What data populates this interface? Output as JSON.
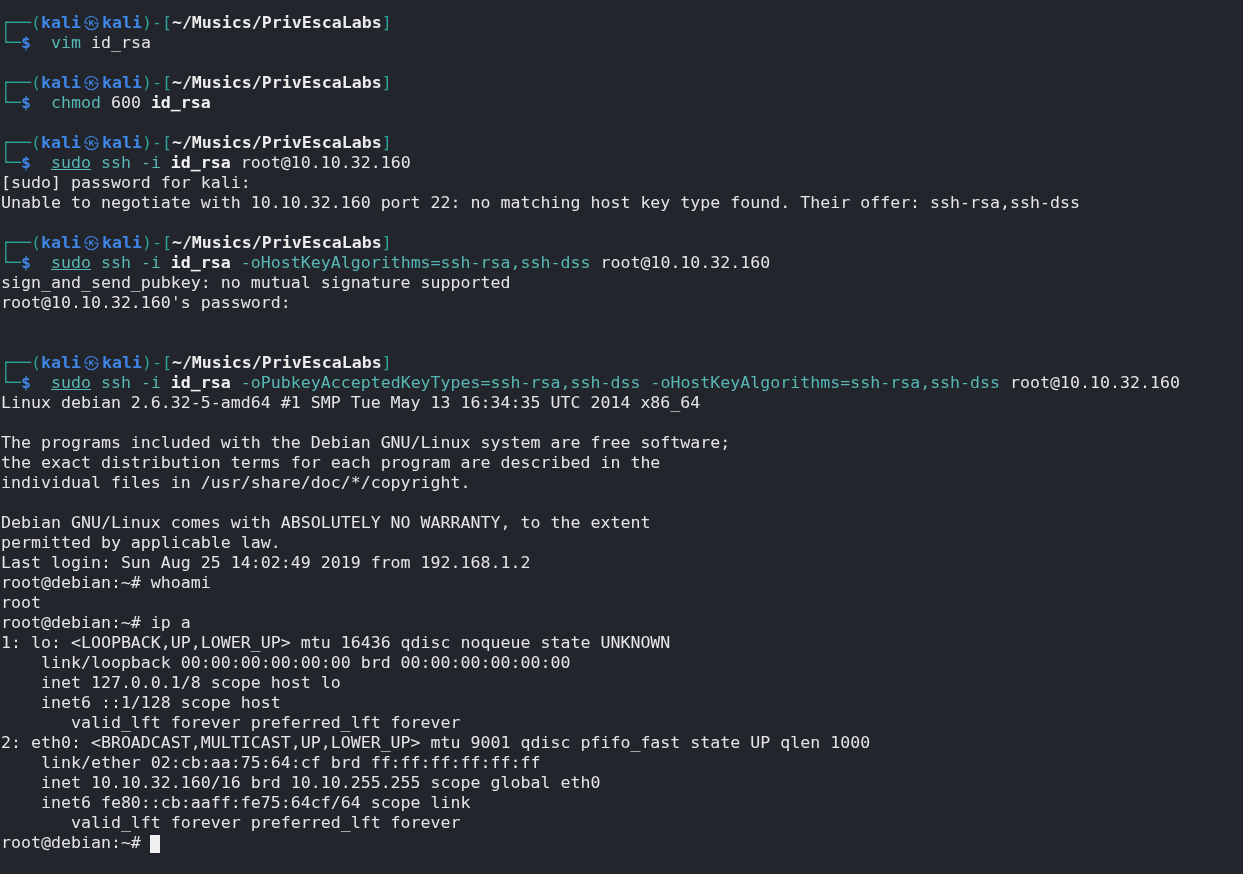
{
  "terminal": {
    "lines": [
      {
        "kind": "prompt",
        "open": "┌──(",
        "user": "kali",
        "at": "㉿",
        "host": "kali",
        "mid": ")-[",
        "path": "~/Musics/PrivEscaLabs",
        "close": "]"
      },
      {
        "kind": "command",
        "corner": "└─",
        "symbol": "$",
        "tokens": [
          {
            "text": "vim",
            "kind": "cmd"
          },
          {
            "text": "id_rsa",
            "kind": "plain"
          }
        ]
      },
      {
        "kind": "blank"
      },
      {
        "kind": "prompt",
        "open": "┌──(",
        "user": "kali",
        "at": "㉿",
        "host": "kali",
        "mid": ")-[",
        "path": "~/Musics/PrivEscaLabs",
        "close": "]"
      },
      {
        "kind": "command",
        "corner": "└─",
        "symbol": "$",
        "tokens": [
          {
            "text": "chmod",
            "kind": "cmd"
          },
          {
            "text": "600",
            "kind": "plain"
          },
          {
            "text": "id_rsa",
            "kind": "bold"
          }
        ]
      },
      {
        "kind": "blank"
      },
      {
        "kind": "prompt",
        "open": "┌──(",
        "user": "kali",
        "at": "㉿",
        "host": "kali",
        "mid": ")-[",
        "path": "~/Musics/PrivEscaLabs",
        "close": "]"
      },
      {
        "kind": "command",
        "corner": "└─",
        "symbol": "$",
        "tokens": [
          {
            "text": "sudo",
            "kind": "sudo"
          },
          {
            "text": "ssh",
            "kind": "cmd"
          },
          {
            "text": "-i",
            "kind": "cmd"
          },
          {
            "text": "id_rsa",
            "kind": "bold"
          },
          {
            "text": "root@10.10.32.160",
            "kind": "plain"
          }
        ]
      },
      {
        "kind": "output",
        "text": "[sudo] password for kali:"
      },
      {
        "kind": "output",
        "text": "Unable to negotiate with 10.10.32.160 port 22: no matching host key type found. Their offer: ssh-rsa,ssh-dss"
      },
      {
        "kind": "blank"
      },
      {
        "kind": "prompt",
        "open": "┌──(",
        "user": "kali",
        "at": "㉿",
        "host": "kali",
        "mid": ")-[",
        "path": "~/Musics/PrivEscaLabs",
        "close": "]"
      },
      {
        "kind": "command",
        "corner": "└─",
        "symbol": "$",
        "tokens": [
          {
            "text": "sudo",
            "kind": "sudo"
          },
          {
            "text": "ssh",
            "kind": "cmd"
          },
          {
            "text": "-i",
            "kind": "cmd"
          },
          {
            "text": "id_rsa",
            "kind": "bold"
          },
          {
            "text": "-oHostKeyAlgorithms=ssh-rsa,ssh-dss",
            "kind": "cmd"
          },
          {
            "text": "root@10.10.32.160",
            "kind": "plain"
          }
        ]
      },
      {
        "kind": "output",
        "text": "sign_and_send_pubkey: no mutual signature supported"
      },
      {
        "kind": "output",
        "text": "root@10.10.32.160's password:"
      },
      {
        "kind": "blank"
      },
      {
        "kind": "blank"
      },
      {
        "kind": "prompt",
        "open": "┌──(",
        "user": "kali",
        "at": "㉿",
        "host": "kali",
        "mid": ")-[",
        "path": "~/Musics/PrivEscaLabs",
        "close": "]"
      },
      {
        "kind": "command",
        "corner": "└─",
        "symbol": "$",
        "tokens": [
          {
            "text": "sudo",
            "kind": "sudo"
          },
          {
            "text": "ssh",
            "kind": "cmd"
          },
          {
            "text": "-i",
            "kind": "cmd"
          },
          {
            "text": "id_rsa",
            "kind": "bold"
          },
          {
            "text": "-oPubkeyAcceptedKeyTypes=ssh-rsa,ssh-dss",
            "kind": "cmd"
          },
          {
            "text": "-oHostKeyAlgorithms=ssh-rsa,ssh-dss",
            "kind": "cmd"
          },
          {
            "text": "root@10.10.32.160",
            "kind": "plain"
          }
        ]
      },
      {
        "kind": "output",
        "text": "Linux debian 2.6.32-5-amd64 #1 SMP Tue May 13 16:34:35 UTC 2014 x86_64"
      },
      {
        "kind": "blank"
      },
      {
        "kind": "output",
        "text": "The programs included with the Debian GNU/Linux system are free software;"
      },
      {
        "kind": "output",
        "text": "the exact distribution terms for each program are described in the"
      },
      {
        "kind": "output",
        "text": "individual files in /usr/share/doc/*/copyright."
      },
      {
        "kind": "blank"
      },
      {
        "kind": "output",
        "text": "Debian GNU/Linux comes with ABSOLUTELY NO WARRANTY, to the extent"
      },
      {
        "kind": "output",
        "text": "permitted by applicable law."
      },
      {
        "kind": "output",
        "text": "Last login: Sun Aug 25 14:02:49 2019 from 192.168.1.2"
      },
      {
        "kind": "output",
        "text": "root@debian:~# whoami"
      },
      {
        "kind": "output",
        "text": "root"
      },
      {
        "kind": "output",
        "text": "root@debian:~# ip a"
      },
      {
        "kind": "output",
        "text": "1: lo: <LOOPBACK,UP,LOWER_UP> mtu 16436 qdisc noqueue state UNKNOWN"
      },
      {
        "kind": "output",
        "text": "    link/loopback 00:00:00:00:00:00 brd 00:00:00:00:00:00"
      },
      {
        "kind": "output",
        "text": "    inet 127.0.0.1/8 scope host lo"
      },
      {
        "kind": "output",
        "text": "    inet6 ::1/128 scope host"
      },
      {
        "kind": "output",
        "text": "       valid_lft forever preferred_lft forever"
      },
      {
        "kind": "output",
        "text": "2: eth0: <BROADCAST,MULTICAST,UP,LOWER_UP> mtu 9001 qdisc pfifo_fast state UP qlen 1000"
      },
      {
        "kind": "output",
        "text": "    link/ether 02:cb:aa:75:64:cf brd ff:ff:ff:ff:ff:ff"
      },
      {
        "kind": "output",
        "text": "    inet 10.10.32.160/16 brd 10.10.255.255 scope global eth0"
      },
      {
        "kind": "output",
        "text": "    inet6 fe80::cb:aaff:fe75:64cf/64 scope link"
      },
      {
        "kind": "output",
        "text": "       valid_lft forever preferred_lft forever"
      },
      {
        "kind": "input",
        "text": "root@debian:~#"
      }
    ]
  }
}
